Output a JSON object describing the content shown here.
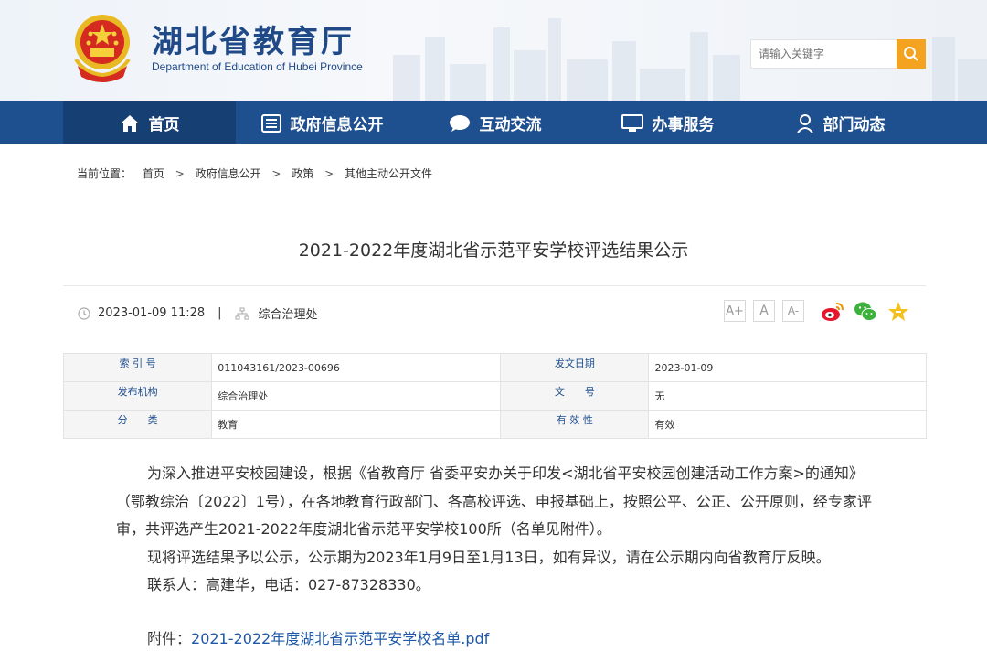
{
  "header": {
    "title": "湖北省教育厅",
    "subtitle": "Department of Education of Hubei Province",
    "search_placeholder": "请输入关键字"
  },
  "nav": [
    {
      "label": "首页",
      "icon": "home-icon"
    },
    {
      "label": "政府信息公开",
      "icon": "document-list-icon"
    },
    {
      "label": "互动交流",
      "icon": "chat-icon"
    },
    {
      "label": "办事服务",
      "icon": "monitor-icon"
    },
    {
      "label": "部门动态",
      "icon": "person-icon"
    }
  ],
  "breadcrumb": {
    "prefix": "当前位置：",
    "items": [
      "首页",
      "政府信息公开",
      "政策",
      "其他主动公开文件"
    ],
    "sep": ">"
  },
  "article": {
    "title": "2021-2022年度湖北省示范平安学校评选结果公示",
    "date": "2023-01-09 11:28",
    "pipe": "|",
    "department": "综合治理处",
    "font_sizes": [
      "A+",
      "A",
      "A-"
    ]
  },
  "info_table": [
    {
      "l1": "索 引 号",
      "v1": "011043161/2023-00696",
      "l2": "发文日期",
      "v2": "2023-01-09"
    },
    {
      "l1": "发布机构",
      "v1": "综合治理处",
      "l2": "文　　号",
      "v2": "无"
    },
    {
      "l1": "分　　类",
      "v1": "教育",
      "l2": "有 效 性",
      "v2": "有效"
    }
  ],
  "body": {
    "p1": "为深入推进平安校园建设，根据《省教育厅 省委平安办关于印发<湖北省平安校园创建活动工作方案>的通知》（鄂教综治〔2022〕1号），在各地教育行政部门、各高校评选、申报基础上，按照公平、公正、公开原则，经专家评审，共评选产生2021-2022年度湖北省示范平安学校100所（名单见附件）。",
    "p2": "现将评选结果予以公示，公示期为2023年1月9日至1月13日，如有异议，请在公示期内向省教育厅反映。",
    "p3": "联系人：高建华，电话：027-87328330。",
    "attach_label": "附件：",
    "attach_link": "2021-2022年度湖北省示范平安学校名单.pdf"
  },
  "colors": {
    "nav_bg": "#1e4f8e",
    "accent": "#f4a321",
    "link": "#1e58a8"
  }
}
